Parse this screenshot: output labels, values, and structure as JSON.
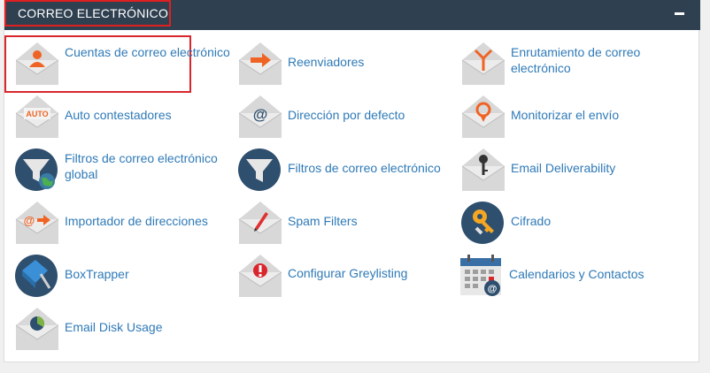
{
  "section": {
    "title": "CORREO ELECTRÓNICO",
    "header_color": "#2f4050",
    "link_color": "#2f7ab7",
    "highlight_color": "#d9262c"
  },
  "items": [
    {
      "label": "Cuentas de correo electrónico",
      "icon": "envelope-user-icon"
    },
    {
      "label": "Reenviadores",
      "icon": "envelope-forward-icon"
    },
    {
      "label": "Enrutamiento de correo electrónico",
      "icon": "envelope-routing-icon"
    },
    {
      "label": "Auto contestadores",
      "icon": "envelope-auto-icon"
    },
    {
      "label": "Dirección por defecto",
      "icon": "envelope-at-icon"
    },
    {
      "label": "Monitorizar el envío",
      "icon": "envelope-location-pin-icon"
    },
    {
      "label": "Filtros de correo electrónico global",
      "icon": "funnel-globe-icon"
    },
    {
      "label": "Filtros de correo electrónico",
      "icon": "funnel-icon"
    },
    {
      "label": "Email Deliverability",
      "icon": "envelope-key-icon"
    },
    {
      "label": "Importador de direcciones",
      "icon": "envelope-import-icon"
    },
    {
      "label": "Spam Filters",
      "icon": "envelope-pencil-icon"
    },
    {
      "label": "Cifrado",
      "icon": "keys-icon"
    },
    {
      "label": "BoxTrapper",
      "icon": "box-trap-icon"
    },
    {
      "label": "Configurar Greylisting",
      "icon": "envelope-alert-icon"
    },
    {
      "label": "Calendarios y Contactos",
      "icon": "calendar-at-icon"
    },
    {
      "label": "Email Disk Usage",
      "icon": "envelope-pie-chart-icon"
    }
  ]
}
